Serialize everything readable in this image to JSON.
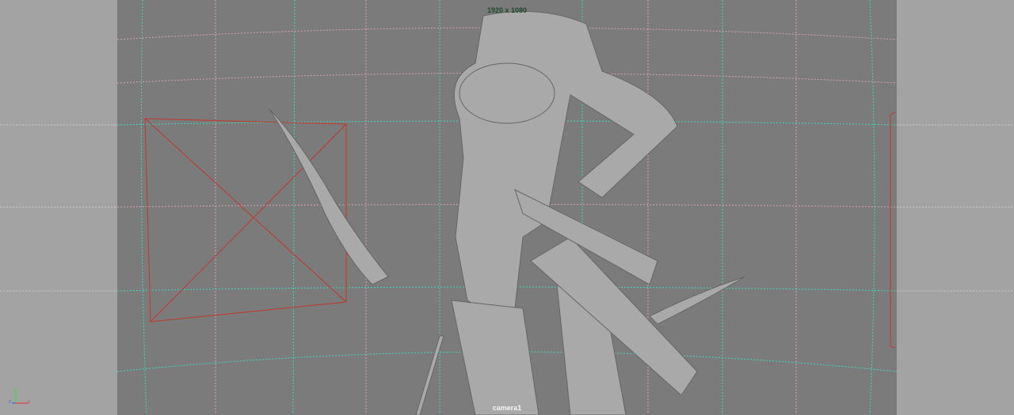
{
  "viewport": {
    "resolution_label": "1920 x 1080",
    "camera_label": "camera1",
    "colors": {
      "bg": "#7b7b7b",
      "gate": "#a3a3a3",
      "grid_cyan": "#3fd6b8",
      "grid_pink": "#d7a0b0",
      "model": "#a9a9a9"
    }
  },
  "axis_indicator": {
    "x": "x",
    "y": "y",
    "z": "z"
  }
}
